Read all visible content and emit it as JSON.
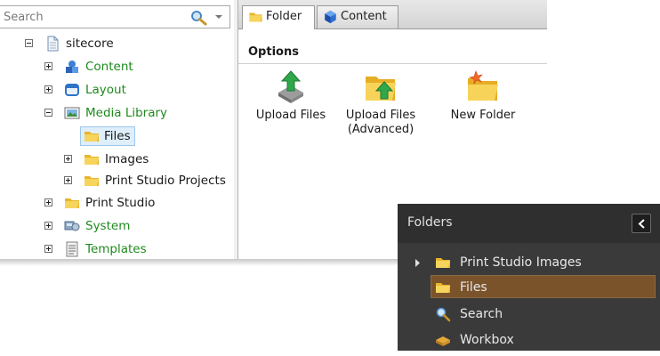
{
  "search": {
    "placeholder": "Search"
  },
  "tree": {
    "root": "sitecore",
    "items": [
      {
        "label": "Content",
        "icon": "content-icon"
      },
      {
        "label": "Layout",
        "icon": "layout-icon"
      },
      {
        "label": "Media Library",
        "icon": "media-library-icon"
      },
      {
        "label": "Files",
        "icon": "folder-icon"
      },
      {
        "label": "Images",
        "icon": "folder-icon"
      },
      {
        "label": "Print Studio Projects",
        "icon": "folder-icon"
      },
      {
        "label": "Print Studio",
        "icon": "folder-icon"
      },
      {
        "label": "System",
        "icon": "system-icon"
      },
      {
        "label": "Templates",
        "icon": "templates-icon"
      }
    ]
  },
  "ribbon": {
    "tabs": [
      {
        "label": "Folder"
      },
      {
        "label": "Content"
      }
    ],
    "group_title": "Options",
    "commands": [
      {
        "label": "Upload Files"
      },
      {
        "label_line1": "Upload Files",
        "label_line2": "(Advanced)"
      },
      {
        "label": "New Folder"
      }
    ]
  },
  "folders_panel": {
    "title": "Folders",
    "items": [
      {
        "label": "Print Studio Images"
      },
      {
        "label": "Files"
      },
      {
        "label": "Search"
      },
      {
        "label": "Workbox"
      }
    ]
  },
  "colors": {
    "tree_text_green": "#1e8a1e",
    "panel_bg": "#3a3a3a",
    "panel_selected": "#7a532b"
  }
}
